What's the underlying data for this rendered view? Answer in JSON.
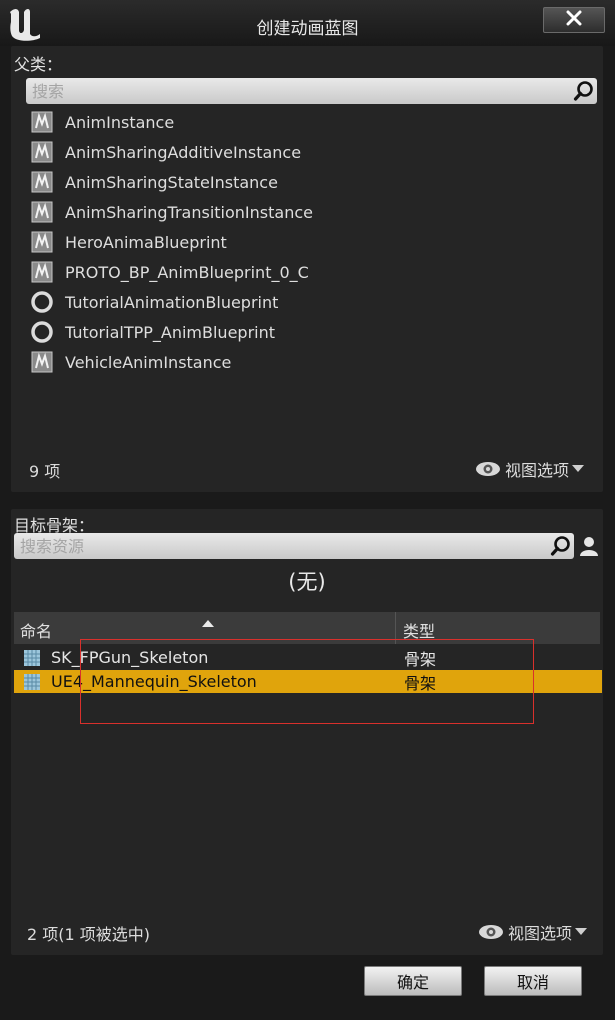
{
  "window": {
    "title": "创建动画蓝图"
  },
  "parent_class": {
    "label": "父类：",
    "search_placeholder": "搜索",
    "items": [
      {
        "label": "AnimInstance",
        "icon": "anim-blueprint-icon"
      },
      {
        "label": "AnimSharingAdditiveInstance",
        "icon": "anim-blueprint-icon"
      },
      {
        "label": "AnimSharingStateInstance",
        "icon": "anim-blueprint-icon"
      },
      {
        "label": "AnimSharingTransitionInstance",
        "icon": "anim-blueprint-icon"
      },
      {
        "label": "HeroAnimaBlueprint",
        "icon": "anim-blueprint-icon"
      },
      {
        "label": "PROTO_BP_AnimBlueprint_0_C",
        "icon": "anim-blueprint-icon"
      },
      {
        "label": "TutorialAnimationBlueprint",
        "icon": "circle-icon"
      },
      {
        "label": "TutorialTPP_AnimBlueprint",
        "icon": "circle-icon"
      },
      {
        "label": "VehicleAnimInstance",
        "icon": "anim-blueprint-icon"
      }
    ],
    "count": "9 项",
    "view_options": "视图选项"
  },
  "target_skeleton": {
    "label": "目标骨架：",
    "search_placeholder": "搜索资源",
    "selected_display": "(无)",
    "columns": {
      "name": "命名",
      "type": "类型"
    },
    "rows": [
      {
        "name": "SK_FPGun_Skeleton",
        "type": "骨架",
        "selected": false
      },
      {
        "name": "UE4_Mannequin_Skeleton",
        "type": "骨架",
        "selected": true
      }
    ],
    "count": "2 项(1 项被选中)",
    "view_options": "视图选项"
  },
  "footer": {
    "ok": "确定",
    "cancel": "取消"
  },
  "colors": {
    "selection": "#e0a40c",
    "annotation_rect": "#d9302c"
  }
}
